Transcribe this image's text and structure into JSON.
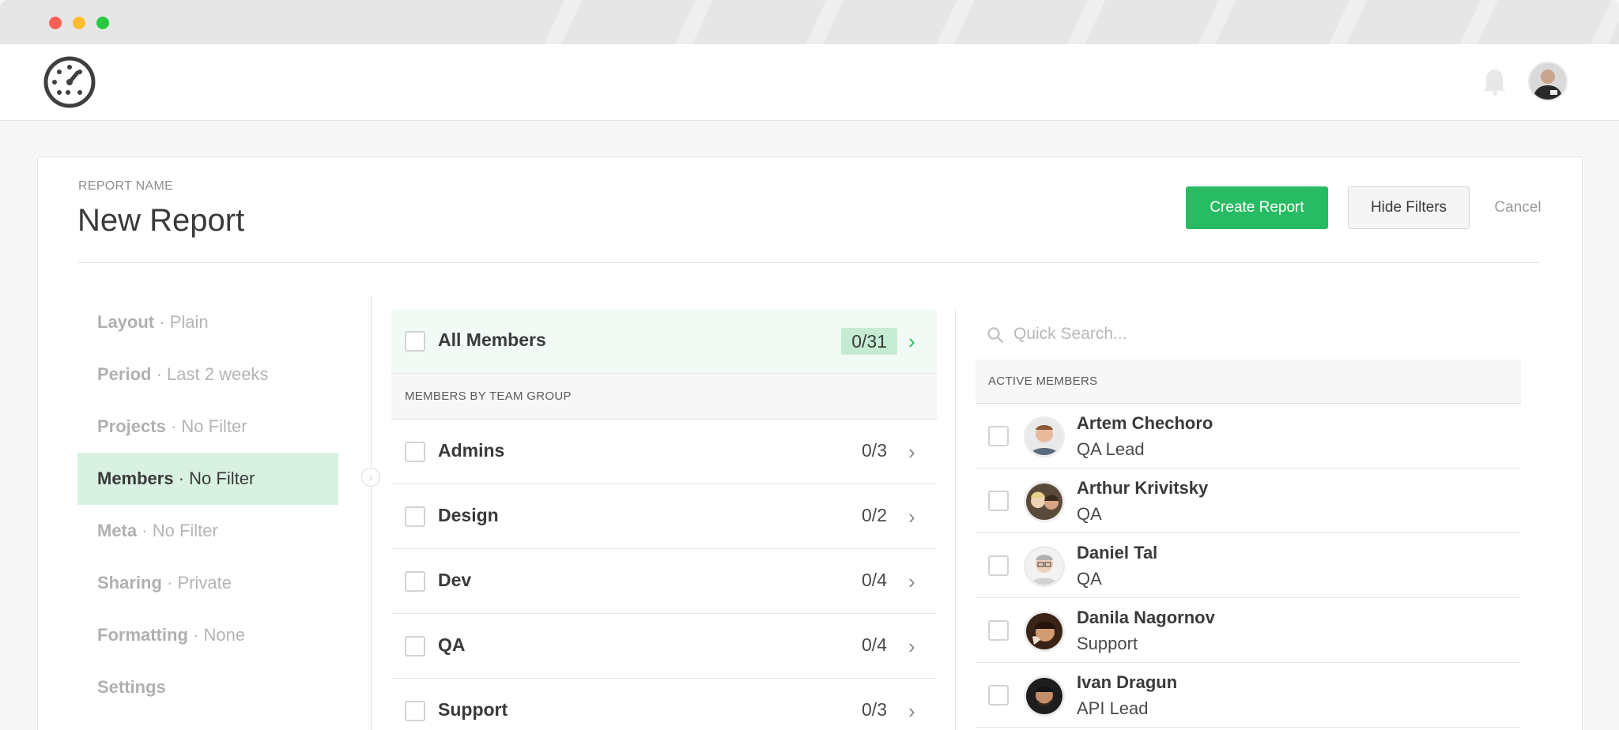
{
  "window": {
    "title": ""
  },
  "header": {
    "logo_icon": "speedometer-logo-icon",
    "bell_icon": "bell-icon",
    "user_avatar": "user-avatar"
  },
  "report": {
    "label": "REPORT NAME",
    "title": "New Report",
    "create_label": "Create Report",
    "hide_filters_label": "Hide Filters",
    "cancel_label": "Cancel"
  },
  "nav": {
    "items": [
      {
        "key": "Layout",
        "value": "Plain",
        "active": false
      },
      {
        "key": "Period",
        "value": "Last 2 weeks",
        "active": false
      },
      {
        "key": "Projects",
        "value": "No Filter",
        "active": false
      },
      {
        "key": "Members",
        "value": "No Filter",
        "active": true
      },
      {
        "key": "Meta",
        "value": "No Filter",
        "active": false
      },
      {
        "key": "Sharing",
        "value": "Private",
        "active": false
      },
      {
        "key": "Formatting",
        "value": "None",
        "active": false
      },
      {
        "key": "Settings",
        "value": "",
        "active": false
      }
    ],
    "separator": "·"
  },
  "groups": {
    "all": {
      "label": "All Members",
      "count": "0/31"
    },
    "section_label": "MEMBERS BY TEAM GROUP",
    "items": [
      {
        "label": "Admins",
        "count": "0/3"
      },
      {
        "label": "Design",
        "count": "0/2"
      },
      {
        "label": "Dev",
        "count": "0/4"
      },
      {
        "label": "QA",
        "count": "0/4"
      },
      {
        "label": "Support",
        "count": "0/3"
      }
    ]
  },
  "members": {
    "search_placeholder": "Quick Search...",
    "section_label": "ACTIVE MEMBERS",
    "items": [
      {
        "name": "Artem Chechoro",
        "role": "QA Lead"
      },
      {
        "name": "Arthur Krivitsky",
        "role": "QA"
      },
      {
        "name": "Daniel Tal",
        "role": "QA"
      },
      {
        "name": "Danila Nagornov",
        "role": "Support"
      },
      {
        "name": "Ivan Dragun",
        "role": "API Lead"
      }
    ]
  },
  "colors": {
    "accent": "#27bc63",
    "active_bg": "#d8f1e1",
    "badge_bg": "#c5ecd2"
  }
}
